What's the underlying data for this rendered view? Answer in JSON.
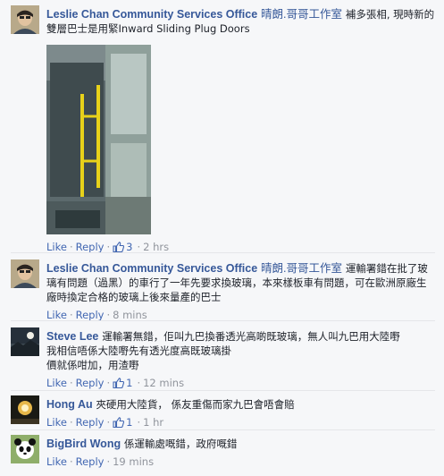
{
  "comments": [
    {
      "name": "Leslie Chan Community Services Office",
      "sub_name": "晴朗.哥哥工作室",
      "text": "補多張相, 現時新的雙層巴士是用緊Inward Sliding Plug Doors",
      "like": "Like",
      "reply": "Reply",
      "likes": "3",
      "time": "2 hrs"
    },
    {
      "name": "Leslie Chan Community Services Office",
      "sub_name": "晴朗.哥哥工作室",
      "text": "運輸署錯在批了玻璃有問題（過黑）的車行了一年先要求換玻璃，本來樣板車有問題，可在歐洲原廠生廠時換定合格的玻璃上後來量產的巴士",
      "like": "Like",
      "reply": "Reply",
      "time": "8 mins"
    },
    {
      "name": "Steve Lee",
      "text": "運輸署無錯，佢叫九巴換番透光高啲既玻璃，無人叫九巴用大陸嘢",
      "text_line2": "我相信唔係大陸嘢先有透光度高既玻璃掛",
      "text_line3": "價就係咁加，用渣嘢",
      "like": "Like",
      "reply": "Reply",
      "likes": "1",
      "time": "12 mins"
    },
    {
      "name": "Hong Au",
      "text": "夾硬用大陸貨，  係友重傷而家九巴會唔會賠",
      "like": "Like",
      "reply": "Reply",
      "likes": "1",
      "time": "1 hr"
    },
    {
      "name": "BigBird Wong",
      "text": "係運輸處嘅錯，政府嘅錯",
      "like": "Like",
      "reply": "Reply",
      "time": "19 mins"
    }
  ],
  "separator": "·",
  "colors": {
    "link": "#365899",
    "meta": "#90949c",
    "background": "#f6f7f9",
    "divider": "#e5e6e9"
  }
}
